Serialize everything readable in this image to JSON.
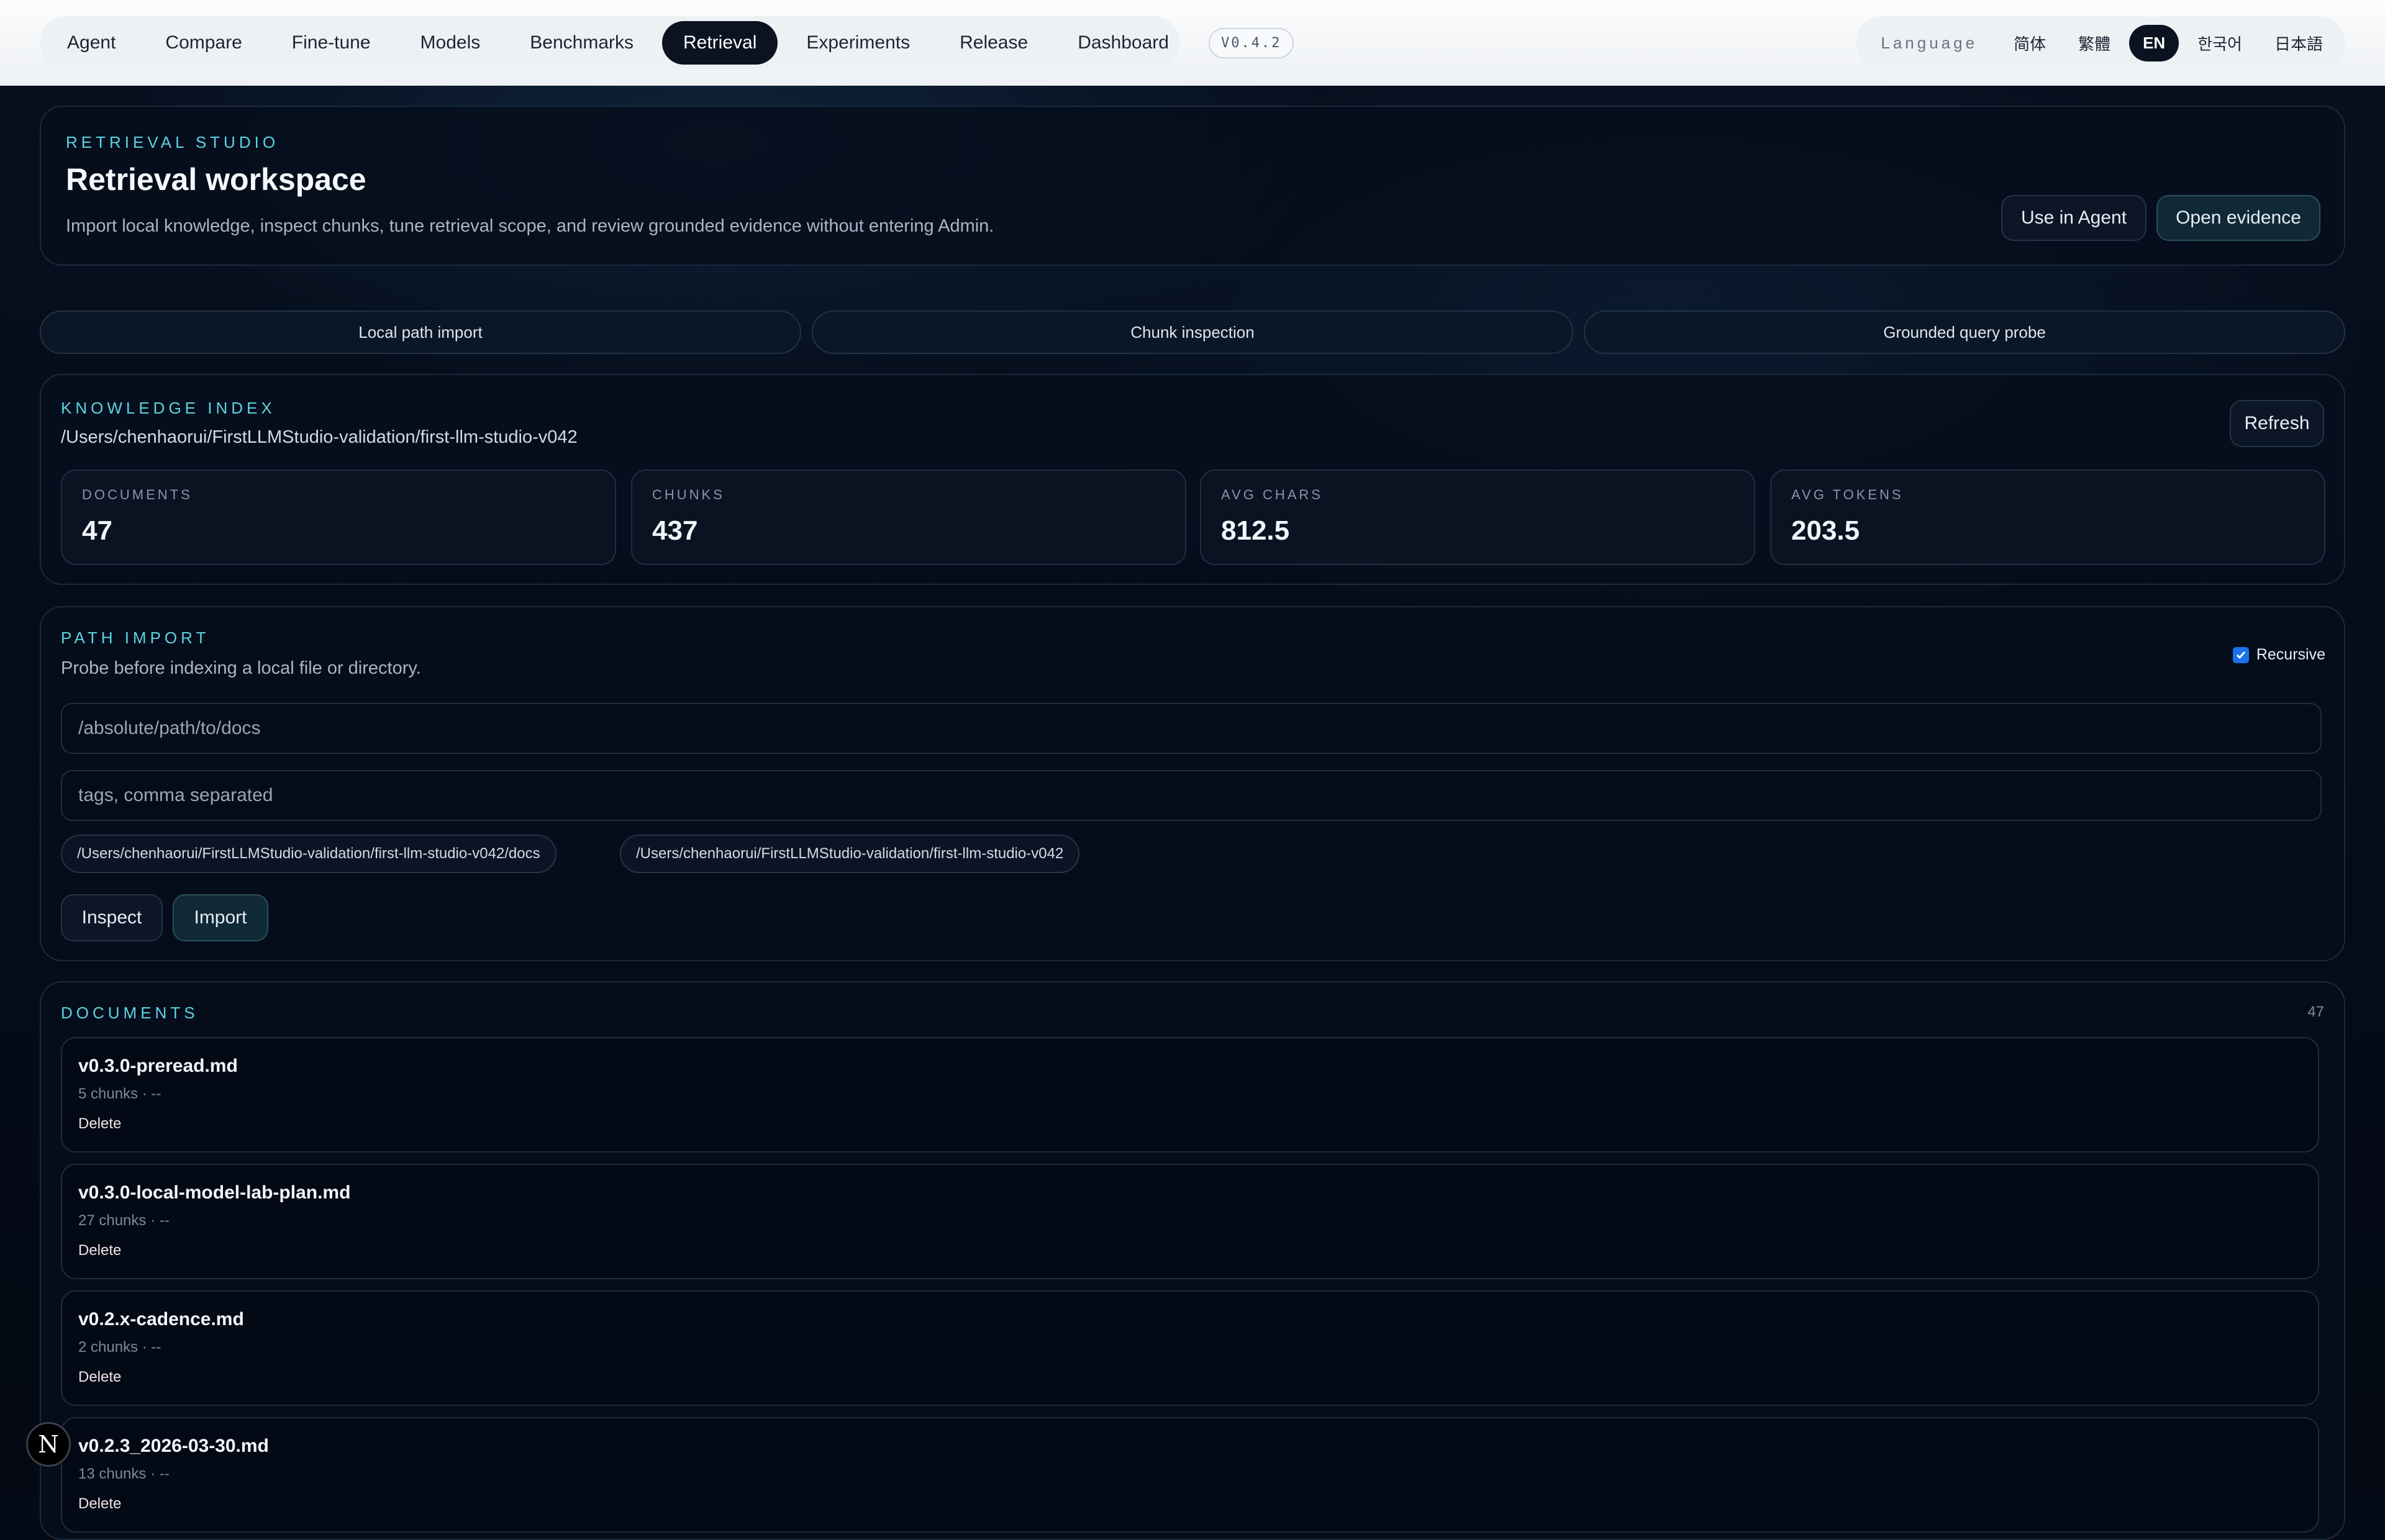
{
  "nav": {
    "items": [
      {
        "label": "Agent",
        "active": false
      },
      {
        "label": "Compare",
        "active": false
      },
      {
        "label": "Fine-tune",
        "active": false
      },
      {
        "label": "Models",
        "active": false
      },
      {
        "label": "Benchmarks",
        "active": false
      },
      {
        "label": "Retrieval",
        "active": true
      },
      {
        "label": "Experiments",
        "active": false
      },
      {
        "label": "Release",
        "active": false
      },
      {
        "label": "Dashboard",
        "active": false
      }
    ],
    "version": "V0.4.2"
  },
  "language": {
    "label": "Language",
    "options": [
      {
        "label": "简体",
        "active": false
      },
      {
        "label": "繁體",
        "active": false
      },
      {
        "label": "EN",
        "active": true
      },
      {
        "label": "한국어",
        "active": false
      },
      {
        "label": "日本語",
        "active": false
      }
    ]
  },
  "hero": {
    "eyebrow": "RETRIEVAL STUDIO",
    "title": "Retrieval workspace",
    "description": "Import local knowledge, inspect chunks, tune retrieval scope, and review grounded evidence without entering Admin.",
    "use_in_agent": "Use in Agent",
    "open_evidence": "Open evidence"
  },
  "tabs": [
    "Local path import",
    "Chunk inspection",
    "Grounded query probe"
  ],
  "index": {
    "eyebrow": "KNOWLEDGE INDEX",
    "path": "/Users/chenhaorui/FirstLLMStudio-validation/first-llm-studio-v042",
    "refresh": "Refresh",
    "stats": [
      {
        "label": "DOCUMENTS",
        "value": "47"
      },
      {
        "label": "CHUNKS",
        "value": "437"
      },
      {
        "label": "AVG CHARS",
        "value": "812.5"
      },
      {
        "label": "AVG TOKENS",
        "value": "203.5"
      }
    ]
  },
  "path_import": {
    "eyebrow": "PATH IMPORT",
    "description": "Probe before indexing a local file or directory.",
    "recursive_label": "Recursive",
    "recursive_checked": true,
    "path_placeholder": "/absolute/path/to/docs",
    "tags_placeholder": "tags, comma separated",
    "suggestions": [
      "/Users/chenhaorui/FirstLLMStudio-validation/first-llm-studio-v042/docs",
      "/Users/chenhaorui/FirstLLMStudio-validation/first-llm-studio-v042"
    ],
    "inspect": "Inspect",
    "import": "Import"
  },
  "documents": {
    "eyebrow": "DOCUMENTS",
    "count": "47",
    "delete_label": "Delete",
    "items": [
      {
        "name": "v0.3.0-preread.md",
        "meta": "5 chunks · --"
      },
      {
        "name": "v0.3.0-local-model-lab-plan.md",
        "meta": "27 chunks · --"
      },
      {
        "name": "v0.2.x-cadence.md",
        "meta": "2 chunks · --"
      },
      {
        "name": "v0.2.3_2026-03-30.md",
        "meta": "13 chunks · --"
      }
    ]
  },
  "floating_badge": "N",
  "colors": {
    "accent": "#5ed3e0",
    "background": "#050b16",
    "nav_active": "#0b1220"
  }
}
